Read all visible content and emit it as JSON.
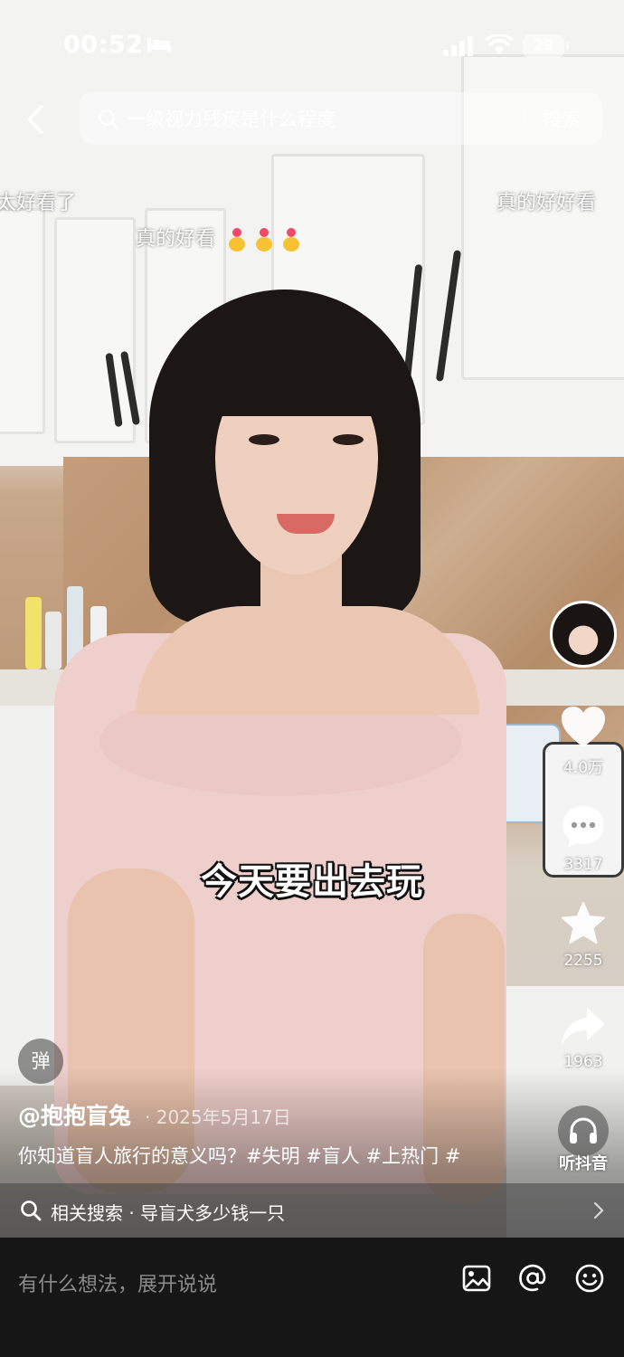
{
  "status_bar": {
    "time": "00:52",
    "battery": "29"
  },
  "search": {
    "query": "一级视力残疾是什么程度",
    "button_label": "搜索"
  },
  "danmaku": [
    {
      "text": "太好看了"
    },
    {
      "text": "真的好好看"
    },
    {
      "text": "真的好看"
    }
  ],
  "video": {
    "subtitle": "今天要出去玩"
  },
  "rail": {
    "likes": "4.0万",
    "comments": "3317",
    "favorites": "2255",
    "shares": "1963",
    "listen_label": "听抖音"
  },
  "post": {
    "danmaku_toggle": "弹",
    "author": "@抱抱盲兔",
    "date": "· 2025年5月17日",
    "caption": "你知道盲人旅行的意义吗？#失明 #盲人 #上热门 #"
  },
  "related": {
    "text": "相关搜索 · 导盲犬多少钱一只"
  },
  "comment": {
    "placeholder": "有什么想法，展开说说"
  },
  "icons": {
    "back": "chevron-left-icon",
    "search": "search-icon",
    "like": "heart-icon",
    "comment": "comment-icon",
    "favorite": "star-icon",
    "share": "share-arrow-icon",
    "listen": "headphones-icon",
    "image": "image-icon",
    "mention": "at-icon",
    "emoji": "emoji-icon"
  }
}
